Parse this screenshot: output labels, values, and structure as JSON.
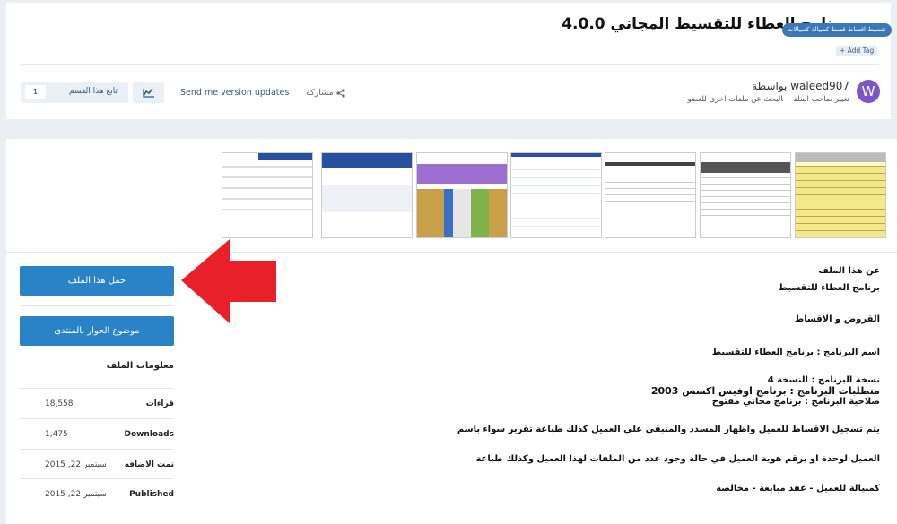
{
  "header": {
    "category_tag": "تقسيط اقساط قسط كمبيالة كمبيالات",
    "title": "برنامج العطاء للتقسيط المجاني 4.0.0",
    "add_tag": "Add Tag"
  },
  "author": {
    "avatar_letter": "W",
    "byline": "بواسطة waleed907",
    "search_files": "البحث عن ملفات اخرى للعضو",
    "change_owner": "تغيير صاحب الملف"
  },
  "actions": {
    "follow_label": "تابع هذا القسم",
    "follow_count": "1",
    "version_updates": "Send me version updates",
    "share": "مشاركة"
  },
  "sidebar": {
    "download_label": "حمل هذا الملف",
    "forum_label": "موضوع الحوار بالمنتدى",
    "info_title": "معلومات الملف",
    "rows": [
      {
        "key": "قراءات",
        "value": "18,558"
      },
      {
        "key": "Downloads",
        "value": "1,475"
      },
      {
        "key": "تمت الاضافه",
        "value": "سبتمبر 22, 2015"
      },
      {
        "key": "Published",
        "value": "سبتمبر 22, 2015"
      }
    ]
  },
  "about": {
    "heading": "عن هذا الملف",
    "lines": [
      "برنامج العطاء للتقسيط",
      "القروض و الاقساط",
      "اسم البرنامج : برنامج العطاء للتقسيط",
      "نسخة البرنامج : النسخة 4",
      "متطلبات البرنامج : برنامج اوفيس اكسس 2003",
      "صلاحية البرنامج : برنامج مجاني مفتوح",
      "يتم تسجيل الاقساط للعميل واظهار المسدد والمتبقي على العميل كذلك طباعة تقرير سواء باسم",
      "العميل لوحدة او برقم هوية العميل في حالة وجود عدد من الملفات لهذا العميل وكذلك طباعة",
      "كمبيالة للعميل - عقد مبايعة - مخالصة"
    ]
  },
  "colors": {
    "primary": "#2a82c7",
    "tag": "#3d77b8",
    "avatar": "#7e55c8",
    "arrow": "#e8202a"
  }
}
